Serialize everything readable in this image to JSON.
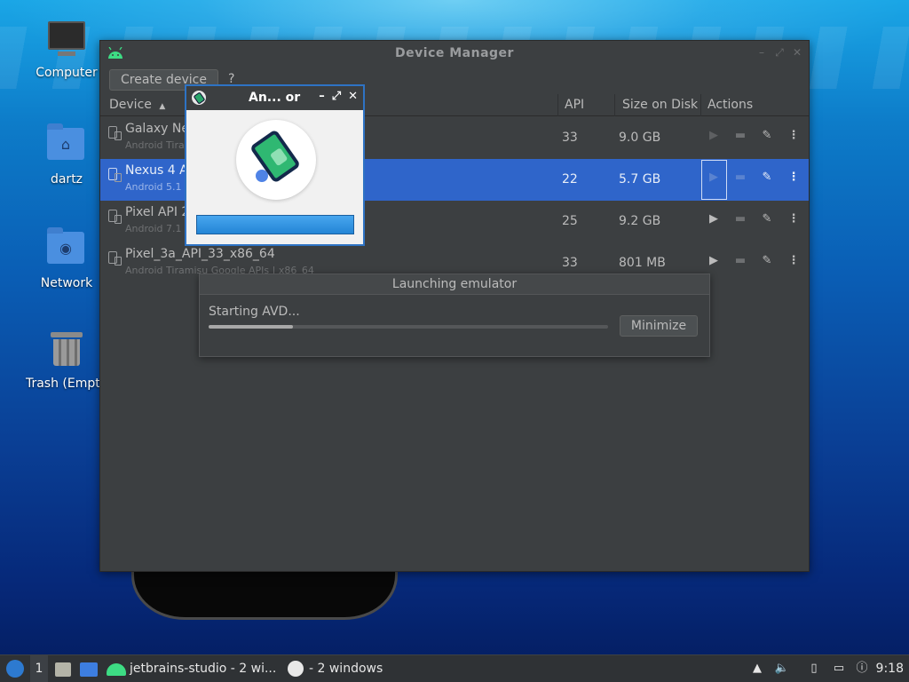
{
  "desktop": {
    "icons": [
      {
        "label": "Computer",
        "icon": "computer-icon"
      },
      {
        "label": "dartz",
        "icon": "home-folder-icon"
      },
      {
        "label": "Network",
        "icon": "network-folder-icon"
      },
      {
        "label": "Trash (Empty",
        "icon": "trash-icon"
      }
    ]
  },
  "device_manager": {
    "title": "Device Manager",
    "create_button": "Create device",
    "help": "?",
    "columns": {
      "device": "Device",
      "sort_indicator": "▲",
      "api": "API",
      "size": "Size on Disk",
      "actions": "Actions"
    },
    "rows": [
      {
        "name": "Galaxy Ne",
        "subtitle": "Android Tira",
        "api": "33",
        "size": "9.0 GB",
        "selected": false
      },
      {
        "name": "Nexus 4 A",
        "subtitle": "Android 5.1",
        "api": "22",
        "size": "5.7 GB",
        "selected": true
      },
      {
        "name": "Pixel API 2",
        "subtitle": "Android 7.1",
        "api": "25",
        "size": "9.2 GB",
        "selected": false
      },
      {
        "name": "Pixel_3a_API_33_x86_64",
        "subtitle": "Android Tiramisu Google APIs | x86_64",
        "api": "33",
        "size": "801 MB",
        "selected": false
      }
    ],
    "action_icons": [
      "play-icon",
      "folder-icon",
      "edit-icon",
      "more-icon"
    ]
  },
  "emulator_splash": {
    "title": "An... or",
    "controls": {
      "minimize": "–",
      "maximize": "⤢",
      "close": "✕"
    }
  },
  "launch_dialog": {
    "title": "Launching emulator",
    "status": "Starting AVD...",
    "progress": 0.21,
    "minimize_button": "Minimize"
  },
  "taskbar": {
    "workspace": "1",
    "task1": "jetbrains-studio - 2 wi...",
    "task2": "- 2 windows",
    "clock": "9:18"
  },
  "colors": {
    "selection": "#2f65ca",
    "window_bg": "#3c3f41",
    "android_green": "#3ddc84"
  }
}
